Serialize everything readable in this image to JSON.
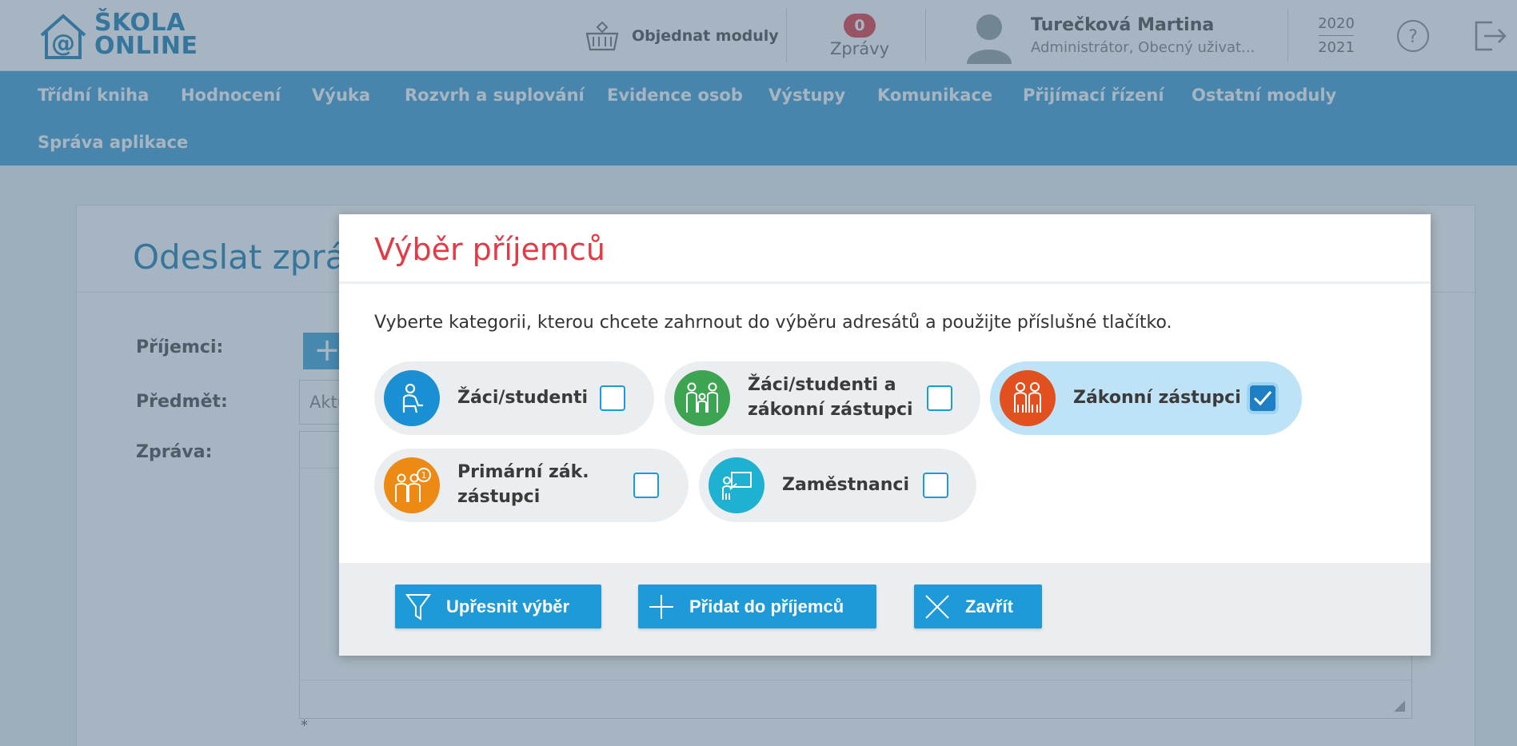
{
  "header": {
    "logo_text_line1": "ŠKOLA",
    "logo_text_line2": "ONLINE",
    "order_modules_label": "Objednat moduly",
    "messages_badge": "0",
    "messages_label": "Zprávy",
    "user_name": "Turečková Martina",
    "user_role": "Administrátor, Obecný uživat...",
    "year_from": "2020",
    "year_to": "2021"
  },
  "nav": {
    "items": [
      "Třídní kniha",
      "Hodnocení",
      "Výuka",
      "Rozvrh a suplování",
      "Evidence osob",
      "Výstupy",
      "Komunikace",
      "Přijímací řízení",
      "Ostatní moduly",
      "Správa aplikace"
    ]
  },
  "page": {
    "title": "Odeslat zprávu",
    "recipients_label": "Příjemci:",
    "subject_label": "Předmět:",
    "subject_value": "Aktu",
    "message_label": "Zpráva:",
    "required_mark": "*"
  },
  "modal": {
    "title": "Výběr příjemců",
    "description": "Vyberte kategorii, kterou chcete zahrnout do výběru adresátů a použijte příslušné tlačítko.",
    "categories": [
      {
        "label_line1": "Žáci/studenti",
        "label_line2": "",
        "icon": "student-icon",
        "color": "#1a8fd4",
        "checked": false
      },
      {
        "label_line1": "Žáci/studenti a",
        "label_line2": "zákonní zástupci",
        "icon": "family-icon",
        "color": "#3da552",
        "checked": false
      },
      {
        "label_line1": "Zákonní zástupci",
        "label_line2": "",
        "icon": "parents-icon",
        "color": "#e2501f",
        "checked": true
      },
      {
        "label_line1": "Primární zák.",
        "label_line2": "zástupci",
        "icon": "primary-parents-icon",
        "color": "#ec8a14",
        "checked": false
      },
      {
        "label_line1": "Zaměstnanci",
        "label_line2": "",
        "icon": "teacher-icon",
        "color": "#1eb1d2",
        "checked": false
      }
    ],
    "buttons": {
      "refine": "Upřesnit výběr",
      "add": "Přidat do příjemců",
      "close": "Zavřít"
    }
  },
  "colors": {
    "accent": "#1f9ad8",
    "nav_bg": "#4ba3d6",
    "modal_title": "#e23b45",
    "badge": "#e5464d"
  }
}
